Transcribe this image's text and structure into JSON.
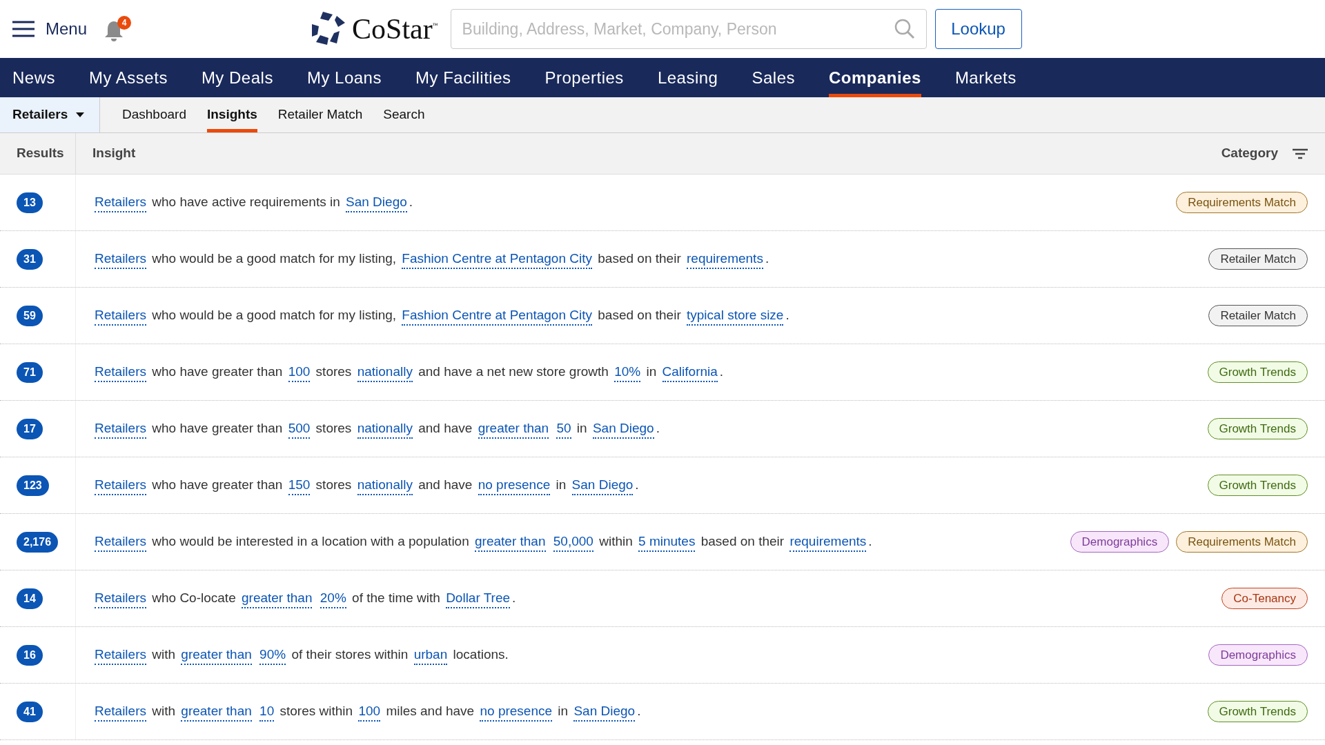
{
  "header": {
    "menu_label": "Menu",
    "notifications": "4",
    "logo_text": "CoStar",
    "logo_mark": "™",
    "search": {
      "placeholder": "Building, Address, Market, Company, Person"
    },
    "lookup_button": "Lookup"
  },
  "nav": [
    {
      "label": "News",
      "selected": false
    },
    {
      "label": "My Assets",
      "selected": false
    },
    {
      "label": "My Deals",
      "selected": false
    },
    {
      "label": "My Loans",
      "selected": false
    },
    {
      "label": "My Facilities",
      "selected": false
    },
    {
      "label": "Properties",
      "selected": false
    },
    {
      "label": "Leasing",
      "selected": false
    },
    {
      "label": "Sales",
      "selected": false
    },
    {
      "label": "Companies",
      "selected": true
    },
    {
      "label": "Markets",
      "selected": false
    }
  ],
  "subnav": {
    "dropdown": "Retailers",
    "tabs": [
      {
        "label": "Dashboard",
        "selected": false
      },
      {
        "label": "Insights",
        "selected": true
      },
      {
        "label": "Retailer Match",
        "selected": false
      },
      {
        "label": "Search",
        "selected": false
      }
    ]
  },
  "table": {
    "columns": [
      "Results",
      "Insight",
      "Category"
    ],
    "rows": [
      {
        "count": "13",
        "segments": [
          {
            "kind": "link",
            "text": "Retailers"
          },
          {
            "kind": "text",
            "text": "who have active requirements in"
          },
          {
            "kind": "link",
            "text": "San Diego"
          },
          {
            "kind": "text",
            "text": "."
          }
        ],
        "tags": [
          {
            "kind": "requirements",
            "label": "Requirements Match"
          }
        ]
      },
      {
        "count": "31",
        "segments": [
          {
            "kind": "link",
            "text": "Retailers"
          },
          {
            "kind": "text",
            "text": "who would be a good match for my listing,"
          },
          {
            "kind": "link",
            "text": "Fashion Centre at Pentagon City"
          },
          {
            "kind": "text",
            "text": "based on their"
          },
          {
            "kind": "link",
            "text": "requirements"
          },
          {
            "kind": "text",
            "text": "."
          }
        ],
        "tags": [
          {
            "kind": "retailer",
            "label": "Retailer Match"
          }
        ]
      },
      {
        "count": "59",
        "segments": [
          {
            "kind": "link",
            "text": "Retailers"
          },
          {
            "kind": "text",
            "text": "who would be a good match for my listing,"
          },
          {
            "kind": "link",
            "text": "Fashion Centre at Pentagon City"
          },
          {
            "kind": "text",
            "text": "based on their"
          },
          {
            "kind": "link",
            "text": "typical store size"
          },
          {
            "kind": "text",
            "text": "."
          }
        ],
        "tags": [
          {
            "kind": "retailer",
            "label": "Retailer Match"
          }
        ]
      },
      {
        "count": "71",
        "segments": [
          {
            "kind": "link",
            "text": "Retailers"
          },
          {
            "kind": "text",
            "text": "who have greater than"
          },
          {
            "kind": "link",
            "text": "100"
          },
          {
            "kind": "text",
            "text": "stores"
          },
          {
            "kind": "link",
            "text": "nationally"
          },
          {
            "kind": "text",
            "text": "and have a net new store growth"
          },
          {
            "kind": "link",
            "text": "10%"
          },
          {
            "kind": "text",
            "text": "in"
          },
          {
            "kind": "link",
            "text": "California"
          },
          {
            "kind": "text",
            "text": "."
          }
        ],
        "tags": [
          {
            "kind": "growth",
            "label": "Growth Trends"
          }
        ]
      },
      {
        "count": "17",
        "segments": [
          {
            "kind": "link",
            "text": "Retailers"
          },
          {
            "kind": "text",
            "text": "who have greater than"
          },
          {
            "kind": "link",
            "text": "500"
          },
          {
            "kind": "text",
            "text": "stores"
          },
          {
            "kind": "link",
            "text": "nationally"
          },
          {
            "kind": "text",
            "text": "and have"
          },
          {
            "kind": "link",
            "text": "greater than"
          },
          {
            "kind": "link",
            "text": "50"
          },
          {
            "kind": "text",
            "text": "in"
          },
          {
            "kind": "link",
            "text": "San Diego"
          },
          {
            "kind": "text",
            "text": "."
          }
        ],
        "tags": [
          {
            "kind": "growth",
            "label": "Growth Trends"
          }
        ]
      },
      {
        "count": "123",
        "segments": [
          {
            "kind": "link",
            "text": "Retailers"
          },
          {
            "kind": "text",
            "text": "who have greater than"
          },
          {
            "kind": "link",
            "text": "150"
          },
          {
            "kind": "text",
            "text": "stores"
          },
          {
            "kind": "link",
            "text": "nationally"
          },
          {
            "kind": "text",
            "text": "and have"
          },
          {
            "kind": "link",
            "text": "no presence"
          },
          {
            "kind": "text",
            "text": "in"
          },
          {
            "kind": "link",
            "text": "San Diego"
          },
          {
            "kind": "text",
            "text": "."
          }
        ],
        "tags": [
          {
            "kind": "growth",
            "label": "Growth Trends"
          }
        ]
      },
      {
        "count": "2,176",
        "segments": [
          {
            "kind": "link",
            "text": "Retailers"
          },
          {
            "kind": "text",
            "text": "who would be interested in a location with a population"
          },
          {
            "kind": "link",
            "text": "greater than"
          },
          {
            "kind": "link",
            "text": "50,000"
          },
          {
            "kind": "text",
            "text": "within"
          },
          {
            "kind": "link",
            "text": "5 minutes"
          },
          {
            "kind": "text",
            "text": "based on their"
          },
          {
            "kind": "link",
            "text": "requirements"
          },
          {
            "kind": "text",
            "text": "."
          }
        ],
        "tags": [
          {
            "kind": "demographics",
            "label": "Demographics"
          },
          {
            "kind": "requirements",
            "label": "Requirements Match"
          }
        ]
      },
      {
        "count": "14",
        "segments": [
          {
            "kind": "link",
            "text": "Retailers"
          },
          {
            "kind": "text",
            "text": "who Co-locate"
          },
          {
            "kind": "link",
            "text": "greater than"
          },
          {
            "kind": "link",
            "text": "20%"
          },
          {
            "kind": "text",
            "text": "of the time with"
          },
          {
            "kind": "link",
            "text": "Dollar Tree"
          },
          {
            "kind": "text",
            "text": "."
          }
        ],
        "tags": [
          {
            "kind": "cotenancy",
            "label": "Co-Tenancy"
          }
        ]
      },
      {
        "count": "16",
        "segments": [
          {
            "kind": "link",
            "text": "Retailers"
          },
          {
            "kind": "text",
            "text": "with"
          },
          {
            "kind": "link",
            "text": "greater than"
          },
          {
            "kind": "link",
            "text": "90%"
          },
          {
            "kind": "text",
            "text": "of their stores within"
          },
          {
            "kind": "link",
            "text": "urban"
          },
          {
            "kind": "text",
            "text": "locations."
          }
        ],
        "tags": [
          {
            "kind": "demographics",
            "label": "Demographics"
          }
        ]
      },
      {
        "count": "41",
        "segments": [
          {
            "kind": "link",
            "text": "Retailers"
          },
          {
            "kind": "text",
            "text": "with"
          },
          {
            "kind": "link",
            "text": "greater than"
          },
          {
            "kind": "link",
            "text": "10"
          },
          {
            "kind": "text",
            "text": "stores within"
          },
          {
            "kind": "link",
            "text": "100"
          },
          {
            "kind": "text",
            "text": "miles and have"
          },
          {
            "kind": "link",
            "text": "no presence"
          },
          {
            "kind": "text",
            "text": "in"
          },
          {
            "kind": "link",
            "text": "San Diego"
          },
          {
            "kind": "text",
            "text": "."
          }
        ],
        "tags": [
          {
            "kind": "growth",
            "label": "Growth Trends"
          }
        ]
      }
    ]
  }
}
